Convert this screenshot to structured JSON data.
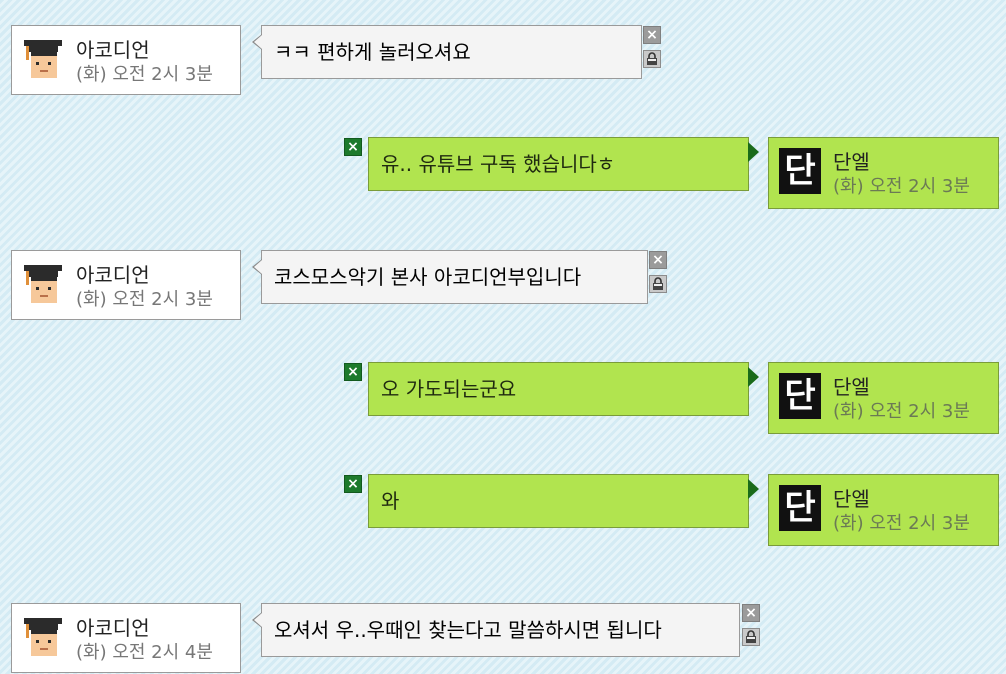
{
  "messages": [
    {
      "side": "left",
      "name": "아코디언",
      "time": "(화) 오전 2시 3분",
      "text": "ㅋㅋ 편하게 놀러오셔요",
      "avatar": "student-avatar-icon"
    },
    {
      "side": "right",
      "name": "단엘",
      "time": "(화) 오전 2시 3분",
      "text": "유.. 유튜브 구독 했습니다ㅎ",
      "avatar": "dan-letter-avatar-icon"
    },
    {
      "side": "left",
      "name": "아코디언",
      "time": "(화) 오전 2시 3분",
      "text": "코스모스악기 본사 아코디언부입니다",
      "avatar": "student-avatar-icon"
    },
    {
      "side": "right",
      "name": "단엘",
      "time": "(화) 오전 2시 3분",
      "text": "오 가도되는군요",
      "avatar": "dan-letter-avatar-icon"
    },
    {
      "side": "right",
      "name": "단엘",
      "time": "(화) 오전 2시 3분",
      "text": "와",
      "avatar": "dan-letter-avatar-icon"
    },
    {
      "side": "left",
      "name": "아코디언",
      "time": "(화) 오전 2시 4분",
      "text": "오셔서 우..우때인 찾는다고 말씀하시면 됩니다",
      "avatar": "student-avatar-icon"
    }
  ],
  "icons": {
    "delete": "close-icon",
    "lock": "lock-icon"
  },
  "avatar_letter": "단",
  "close_glyph": "×",
  "colors": {
    "right_bubble": "#b1e44f",
    "left_bubble": "#f4f4f4",
    "delete_green": "#1d7a2c",
    "delete_gray": "#9b9b9b"
  }
}
